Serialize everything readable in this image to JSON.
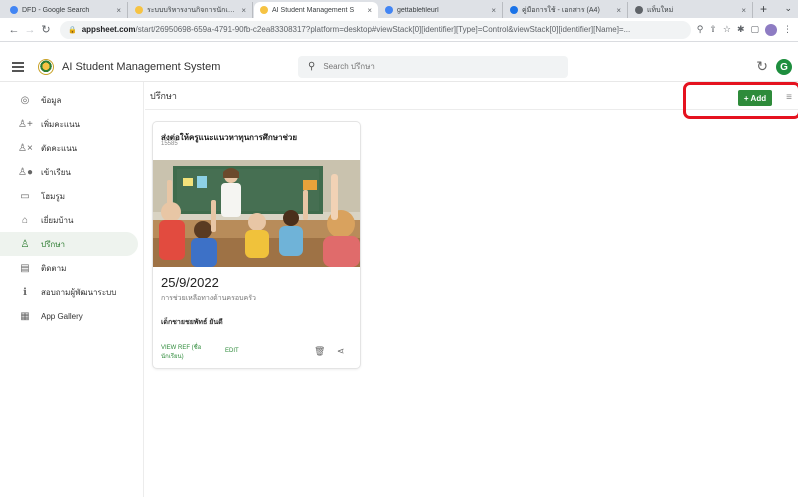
{
  "browser": {
    "tabs": [
      {
        "title": "DFD - Google Search",
        "favicon_color": "#4285f4",
        "active": false
      },
      {
        "title": "ระบบบริหารงานกิจการนักเรียน",
        "favicon_color": "#f6c343",
        "active": false
      },
      {
        "title": "AI Student Management S",
        "favicon_color": "#f6c343",
        "active": true
      },
      {
        "title": "gettablefileurl",
        "favicon_color": "#4285f4",
        "active": false
      },
      {
        "title": "คู่มือการใช้ - เอกสาร (A4)",
        "favicon_color": "#1a73e8",
        "active": false
      },
      {
        "title": "แท็บใหม่",
        "favicon_color": "#5f6368",
        "active": false
      }
    ],
    "new_tab": "+",
    "tab_menu": "⌄",
    "url_host": "appsheet.com",
    "url_path": "/start/26950698-659a-4791-90fb-c2ea83308317?platform=desktop#viewStack[0][identifier][Type]=Control&viewStack[0][identifier][Name]=..."
  },
  "app": {
    "title": "AI Student Management System",
    "search_placeholder": "Search ปรึกษา",
    "avatar_letter": "G"
  },
  "sidebar": {
    "items": [
      {
        "label": "ข้อมูล",
        "icon": "◎",
        "icon_name": "user-circle-icon"
      },
      {
        "label": "เพิ่มคะแนน",
        "icon": "♙+",
        "icon_name": "user-plus-icon"
      },
      {
        "label": "ตัดคะแนน",
        "icon": "♙×",
        "icon_name": "user-remove-icon"
      },
      {
        "label": "เข้าเรียน",
        "icon": "♙●",
        "icon_name": "user-check-icon"
      },
      {
        "label": "โฮมรูม",
        "icon": "▭",
        "icon_name": "classroom-icon"
      },
      {
        "label": "เยี่ยมบ้าน",
        "icon": "⌂",
        "icon_name": "home-visit-icon"
      },
      {
        "label": "ปรึกษา",
        "icon": "♙",
        "icon_name": "counsel-icon"
      },
      {
        "label": "ติดตาม",
        "icon": "▤",
        "icon_name": "tracking-icon"
      },
      {
        "label": "สอบถามผู้พัฒนาระบบ",
        "icon": "ℹ",
        "icon_name": "info-icon"
      },
      {
        "label": "App Gallery",
        "icon": "▦",
        "icon_name": "gallery-icon"
      }
    ],
    "active_index": 6
  },
  "view": {
    "title": "ปรึกษา",
    "add_label": "Add",
    "add_icon": "+",
    "filter_icon": "⚲"
  },
  "card": {
    "title": "ส่งต่อให้ครูแนะแนวหาทุนการศึกษาช่วย",
    "id": "15585",
    "date": "25/9/2022",
    "description": "การช่วยเหลือทางด้านครอบครัว",
    "student_name": "เด็กชายชยพัทธ์ ยันดี",
    "view_ref_label": "VIEW REF (ชื่อนักเรียน)",
    "edit_label": "EDIT",
    "delete_icon": "🗑",
    "share_icon": "⋖"
  },
  "colors": {
    "accent_green": "#2e8b3a",
    "highlight_red": "#e5121f"
  }
}
